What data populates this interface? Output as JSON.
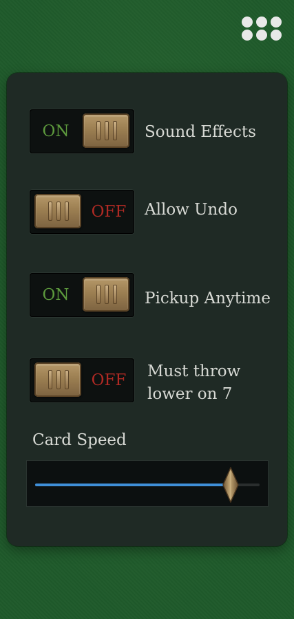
{
  "header": {
    "menu_icon": "grid-dots-icon"
  },
  "settings": {
    "toggles": [
      {
        "label": "Sound Effects",
        "state": "ON"
      },
      {
        "label": "Allow Undo",
        "state": "OFF"
      },
      {
        "label": "Pickup Anytime",
        "state": "ON"
      },
      {
        "label_line1": "Must throw",
        "label_line2": "lower on 7",
        "state": "OFF"
      }
    ]
  },
  "card_speed": {
    "label": "Card Speed",
    "value_fraction": 0.87
  },
  "colors": {
    "table_green": "#1f5a2b",
    "panel": "#1f2a25",
    "on_text": "#5d9a3d",
    "off_text": "#b02a24",
    "slider_fill": "#3f8fd8",
    "knob_brass": "#9c7f52"
  }
}
